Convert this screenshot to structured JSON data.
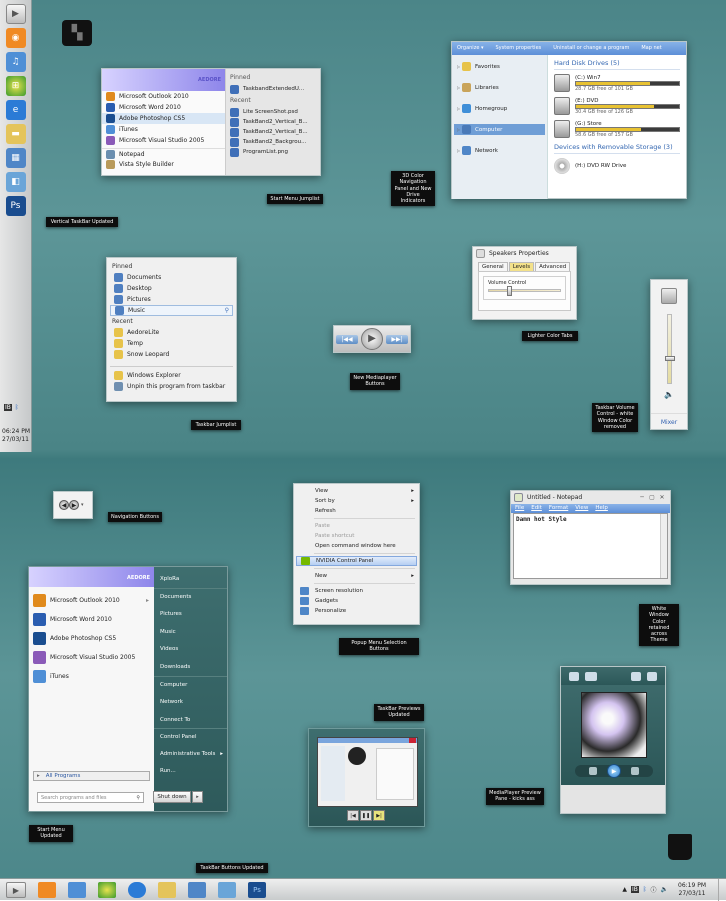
{
  "labels": {
    "vtaskbar": "Vertical TaskBar Updated",
    "startmenu": "Start Menu Jumplist",
    "navpanel": "3D Color Navigation Panel and New Drive Indicators",
    "mediaplayer": "New Mediaplayer Buttons",
    "tabs": "Lighter Color Tabs",
    "volume": "Taskbar Volume Control - white Window Color removed",
    "jumplist": "Taskbar Jumplist",
    "navbuttons": "Navigation Buttons",
    "popup": "Popup Menu Selection Buttons",
    "whitewin": "White Window Color retained across Theme",
    "previews": "TaskBar Previews Updated",
    "mppreview": "MediaPlayer Preview Pane - kicks ass",
    "smupdated": "Start Menu Updated",
    "tbbuttons": "TaskBar Buttons Updated"
  },
  "vtaskbar": {
    "time": "06:24 PM",
    "date": "27/03/11",
    "tray": [
      "IB",
      "bluetooth"
    ]
  },
  "startmenu_small": {
    "brand": "AEDORE",
    "programs": [
      "Microsoft Outlook 2010",
      "Microsoft Word 2010",
      "Adobe Photoshop CS5",
      "iTunes",
      "Microsoft Visual Studio 2005",
      "Notepad",
      "Vista Style Builder"
    ],
    "pinned_title": "Pinned",
    "pinned": [
      "TaskbandExtendedU..."
    ],
    "recent_title": "Recent",
    "recent": [
      "Lite ScreenShot.psd",
      "TaskBand2_Vertical_B...",
      "TaskBand2_Vertical_B...",
      "TaskBand2_Backgrou...",
      "ProgramList.png"
    ]
  },
  "explorer": {
    "toolbar": [
      "Organize ▾",
      "System properties",
      "Uninstall or change a program",
      "Map net"
    ],
    "nav": [
      "Favorites",
      "Libraries",
      "Homegroup",
      "Computer",
      "Network"
    ],
    "hdd_title": "Hard Disk Drives (5)",
    "drives": [
      {
        "name": "(C:) Win7",
        "free": "28.7 GB free of 101 GB",
        "used": 0.72
      },
      {
        "name": "(E:) DVD",
        "free": "30.4 GB free of 126 GB",
        "used": 0.76
      },
      {
        "name": "(G:) Store",
        "free": "58.6 GB free of 157 GB",
        "used": 0.63
      }
    ],
    "removable_title": "Devices with Removable Storage (3)",
    "dvd": "(H:) DVD RW Drive"
  },
  "jumplist": {
    "pinned_title": "Pinned",
    "pinned": [
      "Documents",
      "Desktop",
      "Pictures",
      "Music"
    ],
    "recent_title": "Recent",
    "recent": [
      "AedoreLite",
      "Temp",
      "Snow Leopard"
    ],
    "tasks": [
      "Windows Explorer",
      "Unpin this program from taskbar"
    ]
  },
  "speakers": {
    "title": "Speakers Properties",
    "tabs": [
      "General",
      "Levels",
      "Advanced"
    ],
    "group": "Volume Control",
    "level": 0.25
  },
  "volume": {
    "mixer": "Mixer",
    "level": 0.4
  },
  "context": {
    "items": [
      "View",
      "Sort by",
      "Refresh",
      "",
      "Paste",
      "Paste shortcut",
      "Open command window here",
      "",
      "NVIDIA Control Panel",
      "",
      "New",
      "",
      "Screen resolution",
      "Gadgets",
      "Personalize"
    ]
  },
  "notepad": {
    "title": "Untitled - Notepad",
    "menu": [
      "File",
      "Edit",
      "Format",
      "View",
      "Help"
    ],
    "text": "Damn hot Style"
  },
  "startmenu_big": {
    "brand": "AEDORE",
    "programs": [
      "Microsoft Outlook 2010",
      "Microsoft Word 2010",
      "Adobe Photoshop CS5",
      "Microsoft Visual Studio 2005",
      "iTunes"
    ],
    "all": "All Programs",
    "search": "Search programs and files",
    "shutdown": "Shut down",
    "right": [
      "XploRa",
      "Documents",
      "Pictures",
      "Music",
      "Videos",
      "Downloads",
      "Computer",
      "Network",
      "Connect To",
      "Control Panel",
      "Administrative Tools",
      "Run..."
    ]
  },
  "taskbar": {
    "time": "06:19 PM",
    "date": "27/03/11",
    "tray": [
      "IB",
      "bluetooth"
    ]
  }
}
